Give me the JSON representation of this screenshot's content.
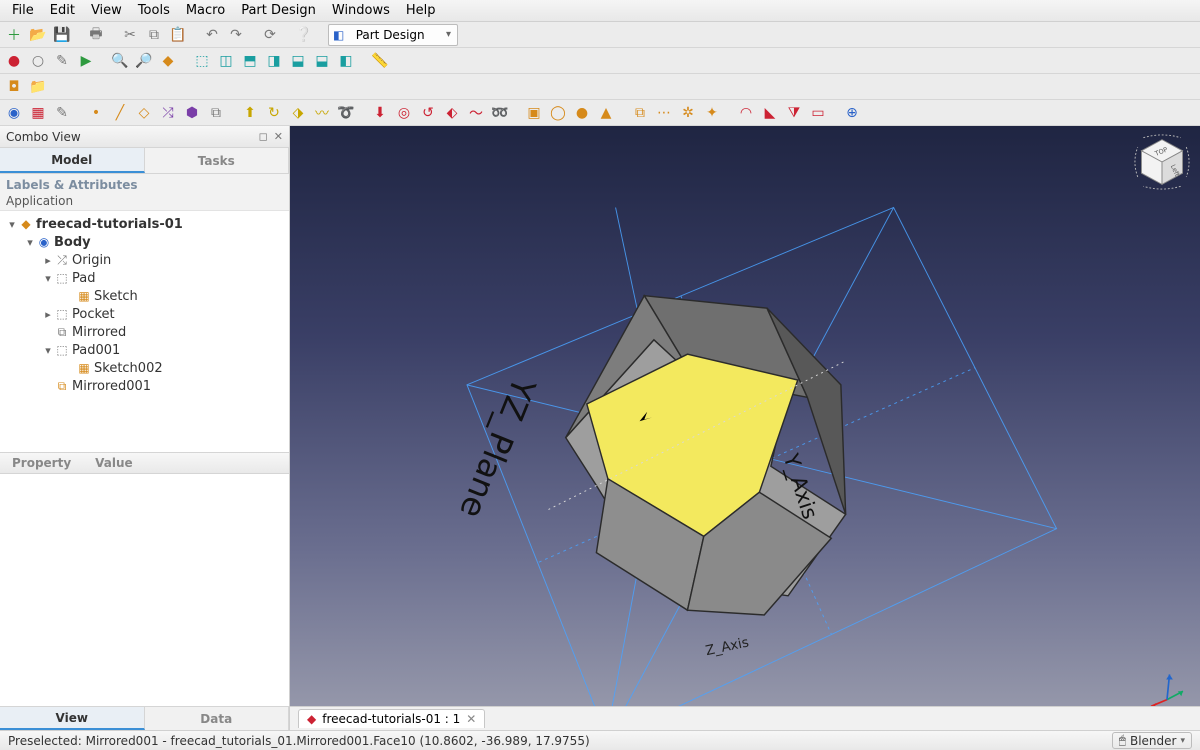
{
  "menu": {
    "items": [
      "File",
      "Edit",
      "View",
      "Tools",
      "Macro",
      "Part Design",
      "Windows",
      "Help"
    ]
  },
  "workbench": {
    "label": "Part Design"
  },
  "combo_view": {
    "title": "Combo View",
    "tab_model": "Model",
    "tab_tasks": "Tasks",
    "section": "Labels & Attributes",
    "app": "Application"
  },
  "tree": {
    "doc": "freecad-tutorials-01",
    "body": "Body",
    "origin": "Origin",
    "pad": "Pad",
    "sketch": "Sketch",
    "pocket": "Pocket",
    "mirrored": "Mirrored",
    "pad001": "Pad001",
    "sketch002": "Sketch002",
    "mirrored001": "Mirrored001"
  },
  "props": {
    "property": "Property",
    "value": "Value"
  },
  "bottom_tabs": {
    "view": "View",
    "data": "Data"
  },
  "viewport": {
    "plane_label_yz": "YZ_Plane",
    "axis_label_y": "Y_Axis",
    "axis_label_z": "Z_Axis",
    "axis_label_other": "ne",
    "navcube_top": "TOP",
    "navcube_left": "Left"
  },
  "doc_tab": {
    "label": "freecad-tutorials-01 : 1"
  },
  "status": {
    "left": "Preselected: Mirrored001 - freecad_tutorials_01.Mirrored001.Face10 (10.8602, -36.989, 17.9755)",
    "nav_style": "Blender"
  }
}
